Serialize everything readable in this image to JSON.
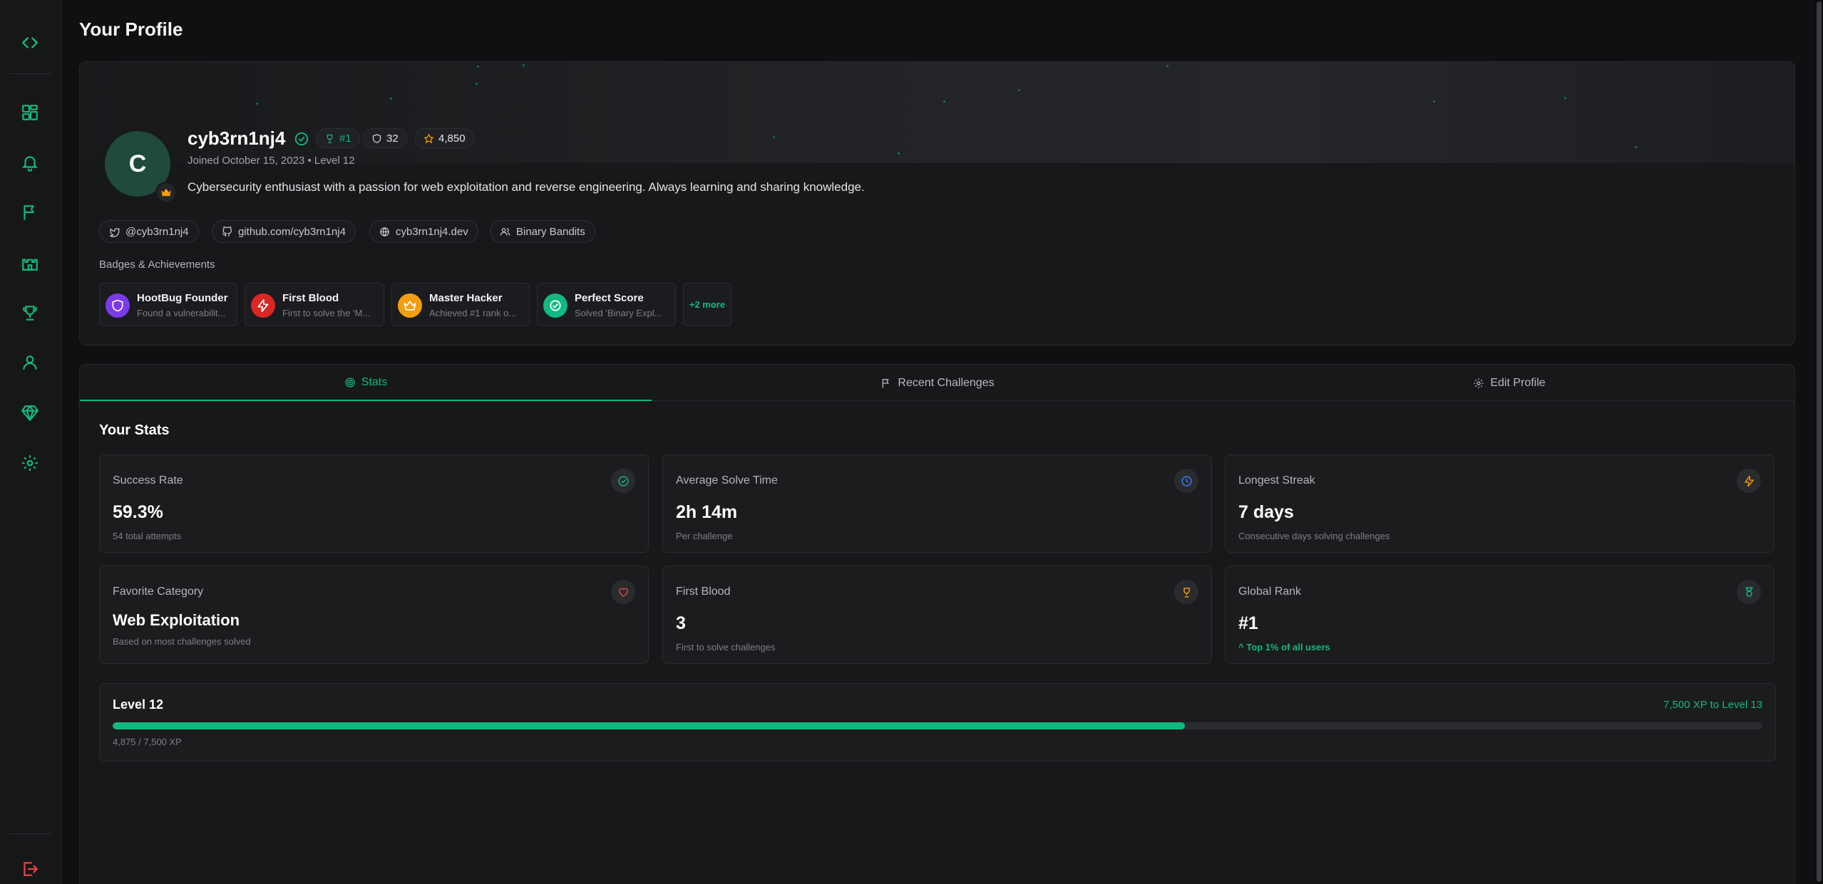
{
  "page": {
    "title": "Your Profile"
  },
  "sidebar": {
    "items": [
      {
        "name": "code-icon"
      },
      {
        "name": "dashboard-icon"
      },
      {
        "name": "bell-icon"
      },
      {
        "name": "flag-icon"
      },
      {
        "name": "castle-icon"
      },
      {
        "name": "trophy-icon"
      },
      {
        "name": "user-icon"
      },
      {
        "name": "gem-icon"
      },
      {
        "name": "gear-icon"
      },
      {
        "name": "logout-icon"
      }
    ]
  },
  "profile": {
    "avatar_initial": "C",
    "username": "cyb3rn1nj4",
    "rank_badge": "#1",
    "shield_count": "32",
    "points": "4,850",
    "joined": "Joined October 15, 2023 • Level 12",
    "bio": "Cybersecurity enthusiast with a passion for web exploitation and reverse engineering. Always learning and sharing knowledge.",
    "links": {
      "twitter": "@cyb3rn1nj4",
      "github": "github.com/cyb3rn1nj4",
      "website": "cyb3rn1nj4.dev",
      "team": "Binary Bandits"
    },
    "badges_title": "Badges & Achievements",
    "badges": [
      {
        "name": "HootBug Founder",
        "desc": "Found a vulnerabilit...",
        "color": "#7c3aed",
        "icon": "shield-icon"
      },
      {
        "name": "First Blood",
        "desc": "First to solve the 'M...",
        "color": "#dc2626",
        "icon": "bolt-icon"
      },
      {
        "name": "Master Hacker",
        "desc": "Achieved #1 rank o...",
        "color": "#f59e0b",
        "icon": "crown-icon"
      },
      {
        "name": "Perfect Score",
        "desc": "Solved 'Binary Expl...",
        "color": "#10b981",
        "icon": "check-icon"
      }
    ],
    "more_badges": "+2 more"
  },
  "tabs": [
    {
      "label": "Stats",
      "icon": "target-icon"
    },
    {
      "label": "Recent Challenges",
      "icon": "flag-icon"
    },
    {
      "label": "Edit Profile",
      "icon": "gear-icon"
    }
  ],
  "stats": {
    "title": "Your Stats",
    "cards": [
      {
        "label": "Success Rate",
        "value": "59.3%",
        "sub": "54 total attempts",
        "icon": "check-circle-icon",
        "color": "#10b981"
      },
      {
        "label": "Average Solve Time",
        "value": "2h 14m",
        "sub": "Per challenge",
        "icon": "clock-icon",
        "color": "#3b82f6"
      },
      {
        "label": "Longest Streak",
        "value": "7 days",
        "sub": "Consecutive days solving challenges",
        "icon": "bolt-icon",
        "color": "#f59e0b"
      },
      {
        "label": "Favorite Category",
        "value": "Web Exploitation",
        "sub": "Based on most challenges solved",
        "icon": "heart-icon",
        "color": "#ef4444"
      },
      {
        "label": "First Blood",
        "value": "3",
        "sub": "First to solve challenges",
        "icon": "trophy-icon",
        "color": "#f59e0b"
      },
      {
        "label": "Global Rank",
        "value": "#1",
        "sub": "Top 1% of all users",
        "icon": "medal-icon",
        "color": "#10b981"
      }
    ]
  },
  "level": {
    "title": "Level 12",
    "next": "7,500 XP to Level 13",
    "xp": "4,875 / 7,500 XP",
    "progress": 0.65
  },
  "colors": {
    "accent": "#10b981",
    "background": "#0f1012",
    "card": "#17181a"
  }
}
